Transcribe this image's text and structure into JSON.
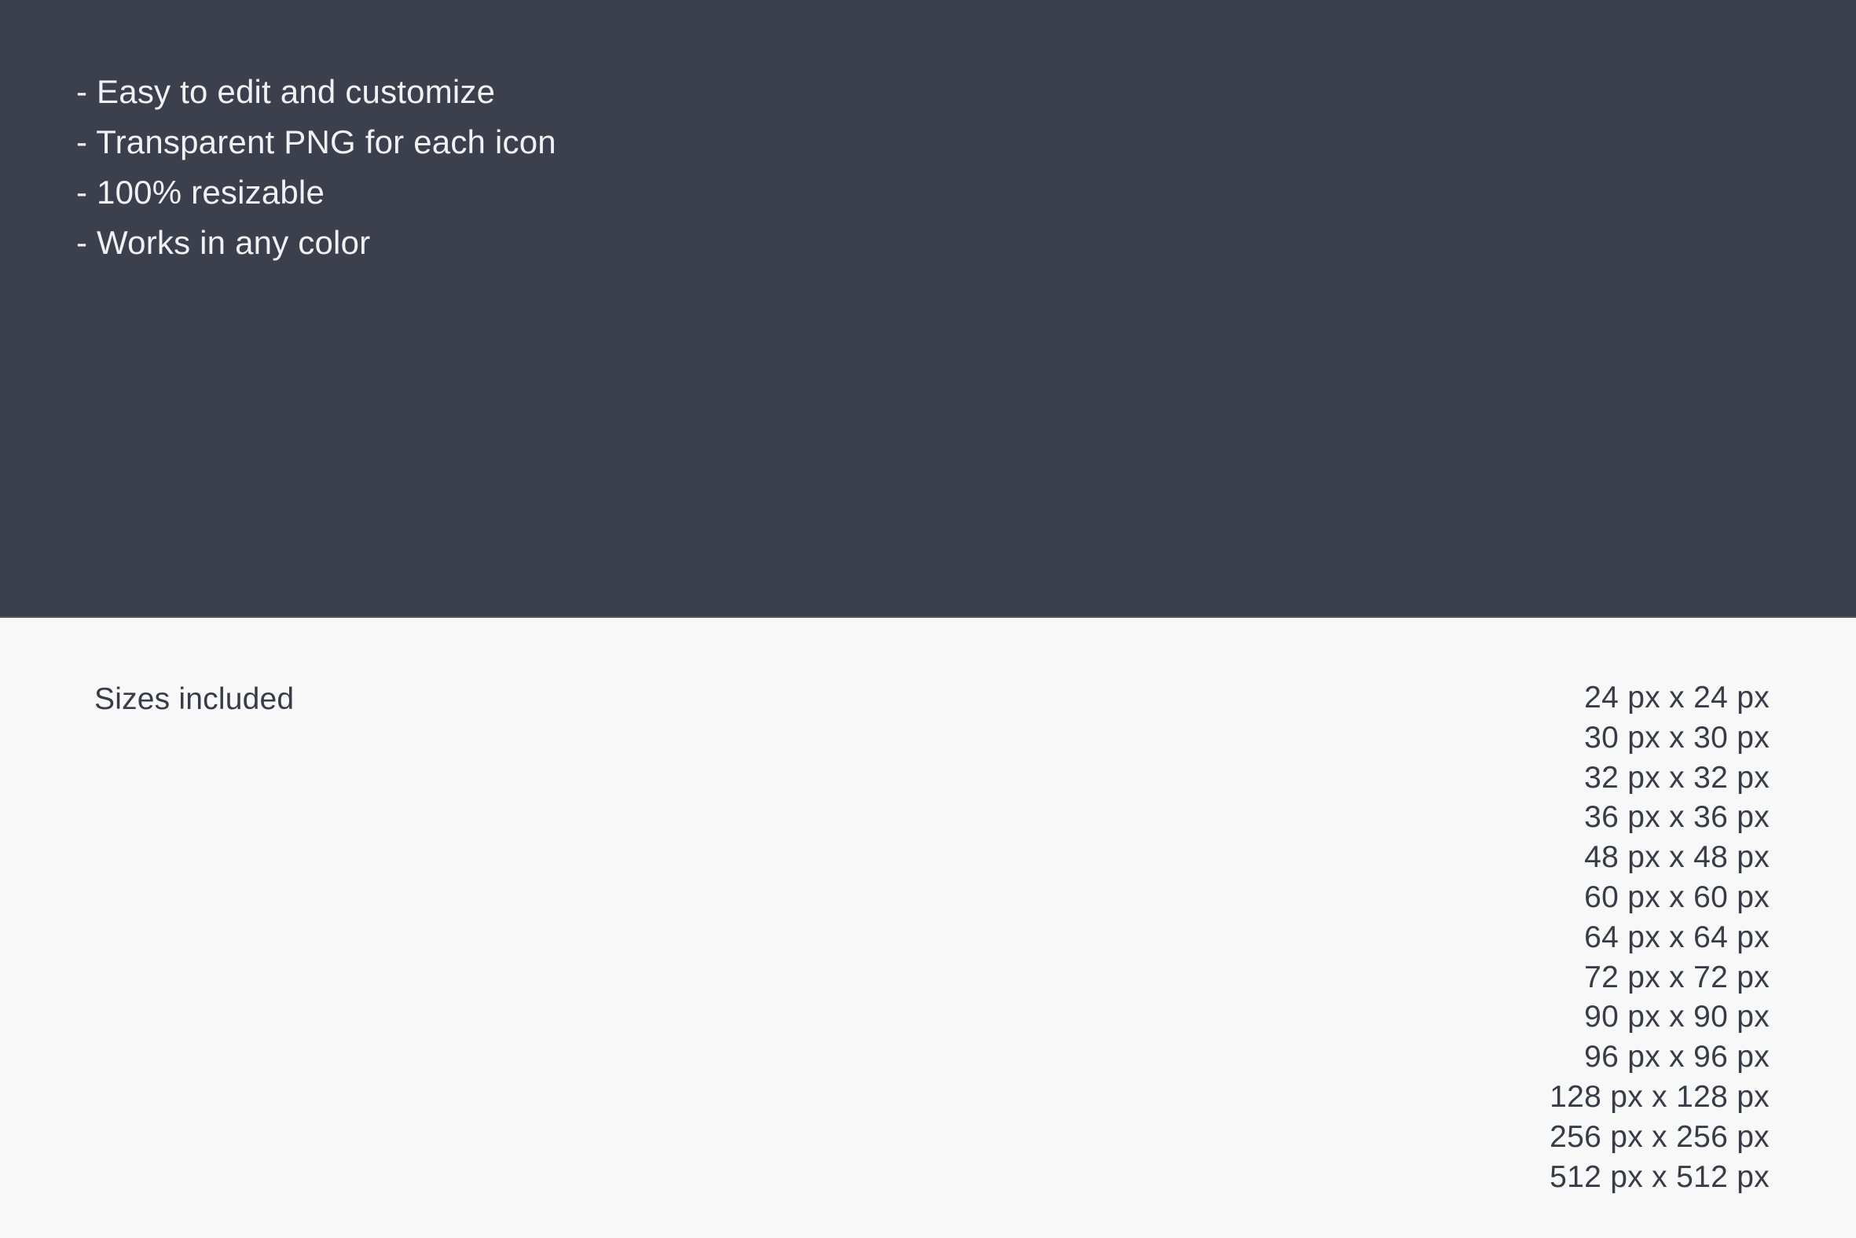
{
  "features": {
    "items": [
      "- Easy to edit and customize",
      "- Transparent PNG for each icon",
      "- 100% resizable",
      "- Works in any color"
    ]
  },
  "sizes": {
    "heading": "Sizes included",
    "items": [
      "24 px x 24 px",
      "30 px x 30 px",
      "32 px x 32 px",
      "36 px x 36 px",
      "48 px x 48 px",
      "60 px x 60 px",
      "64 px x 64 px",
      "72 px x 72 px",
      "90 px x 90 px",
      "96 px x 96 px",
      "128 px x 128 px",
      "256 px x 256 px",
      "512 px x 512 px"
    ]
  },
  "colors": {
    "panel_dark": "#3c404c",
    "panel_light": "#f8f8f8",
    "text_on_dark": "#f1f1f4",
    "text_on_light": "#383c48",
    "divider": "#53565f"
  }
}
